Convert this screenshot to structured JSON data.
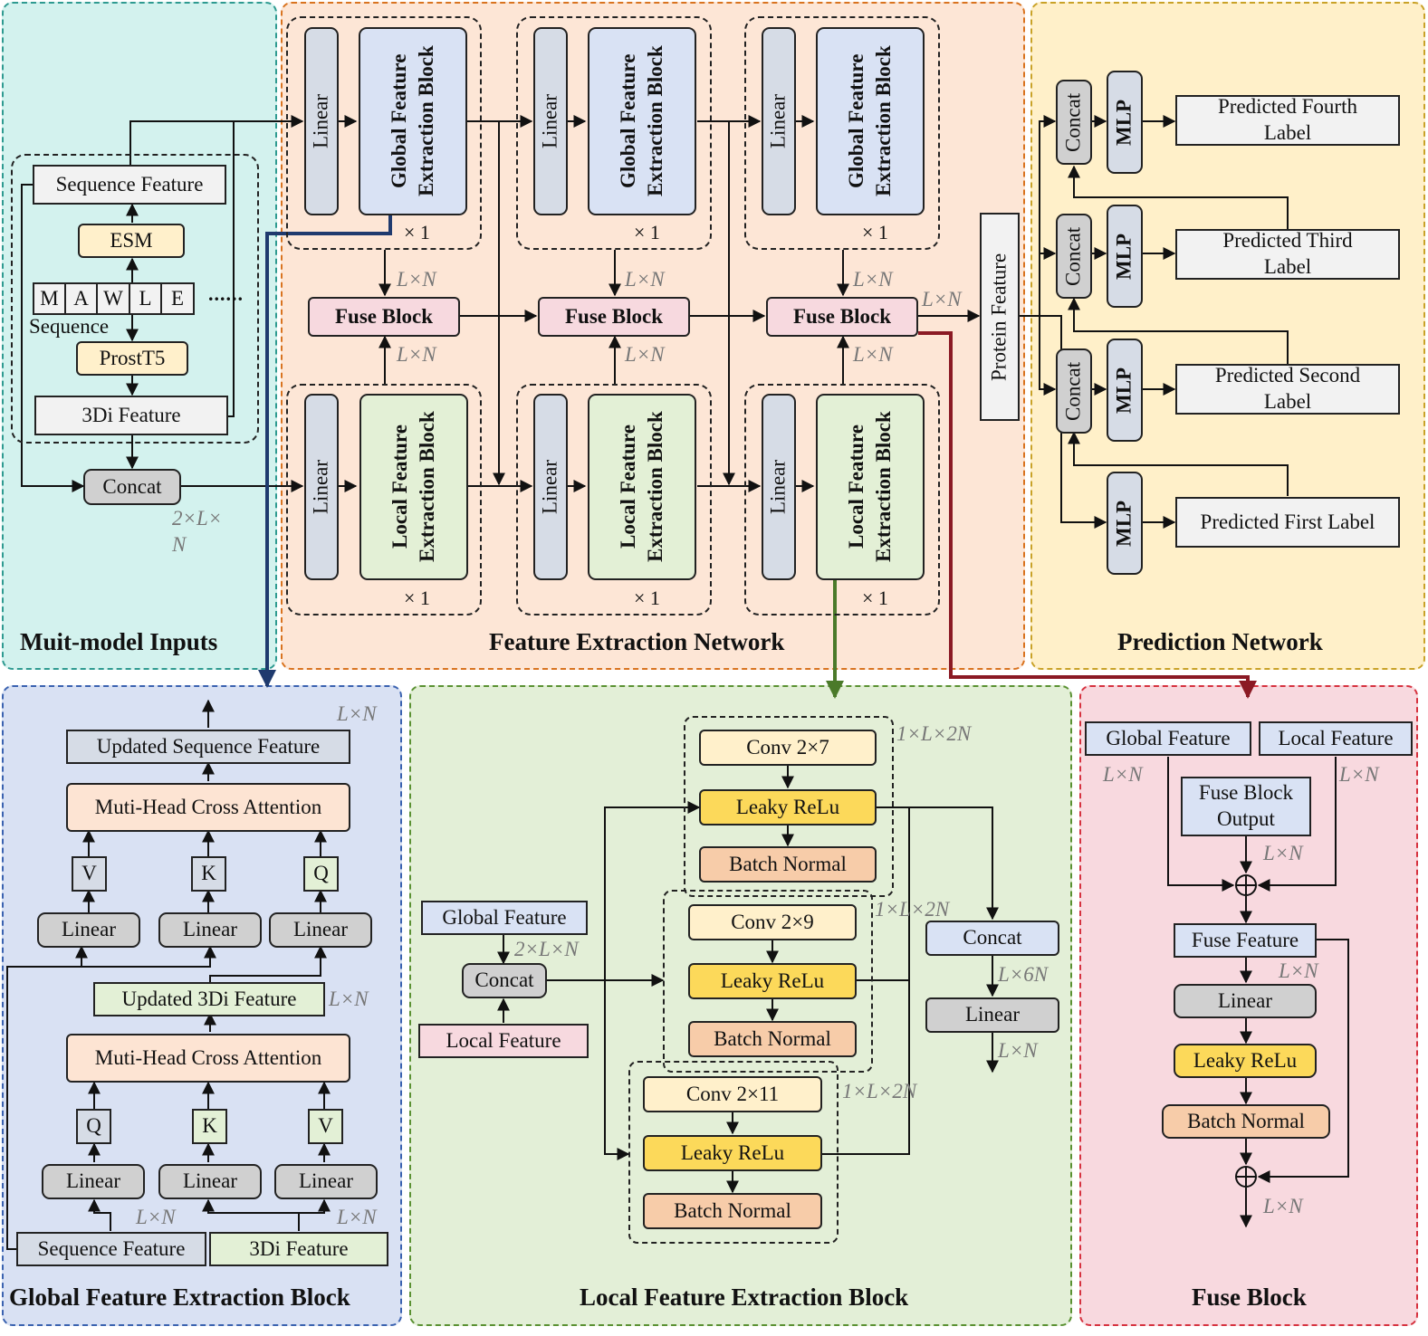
{
  "colors": {
    "inputs_panel": "#d3f2ee",
    "feature_panel": "#fde6d6",
    "prediction_panel": "#fff0c9",
    "global_panel": "#d9e1f3",
    "local_panel": "#e3efd7",
    "fuse_panel": "#f8d9df",
    "global_link": "#1f3a6e",
    "local_link": "#4b7a2a",
    "fuse_link": "#8b1a24"
  },
  "inputs": {
    "title": "Muit-model Inputs",
    "sequence_feature": "Sequence Feature",
    "esm": "ESM",
    "sequence_letters": [
      "M",
      "A",
      "W",
      "L",
      "E"
    ],
    "ellipsis": "......",
    "sequence_label": "Sequence",
    "prostt5": "ProstT5",
    "di3_feature": "3Di Feature",
    "concat": "Concat",
    "concat_dim_line1": "2×L×",
    "concat_dim_line2": "N"
  },
  "feature_network": {
    "title": "Feature Extraction Network",
    "linear": "Linear",
    "global_block": "Global Feature Extraction Block",
    "local_block": "Local Feature Extraction Block",
    "repeat": "× 1",
    "fuse_block": "Fuse Block",
    "dim": "L×N",
    "protein_feature": "Protein Feature"
  },
  "prediction": {
    "title": "Prediction Network",
    "concat": "Concat",
    "mlp": "MLP",
    "labels": [
      "Predicted Fourth Label",
      "Predicted Third Label",
      "Predicted Second Label",
      "Predicted First Label"
    ]
  },
  "global_block": {
    "title": "Global Feature Extraction Block",
    "updated_sequence": "Updated Sequence Feature",
    "attention": "Muti-Head Cross Attention",
    "updated_3di": "Updated 3Di Feature",
    "linear": "Linear",
    "top_qkv": [
      "V",
      "K",
      "Q"
    ],
    "bottom_qkv": [
      "Q",
      "K",
      "V"
    ],
    "sequence_feature": "Sequence Feature",
    "di3_feature": "3Di Feature",
    "dim": "L×N"
  },
  "local_block": {
    "title": "Local Feature Extraction Block",
    "global_feature": "Global Feature",
    "local_feature": "Local Feature",
    "concat": "Concat",
    "concat_dim": "2×L×N",
    "convs": [
      "Conv 2×7",
      "Conv 2×9",
      "Conv 2×11"
    ],
    "leaky": "Leaky ReLu",
    "batch": "Batch Normal",
    "branch_dim": "1×L×2N",
    "out_concat": "Concat",
    "out_concat_dim": "L×6N",
    "linear": "Linear",
    "out_dim": "L×N"
  },
  "fuse_block": {
    "title": "Fuse Block",
    "global_feature": "Global Feature",
    "local_feature": "Local Feature",
    "fuse_output": "Fuse Block Output",
    "fuse_feature": "Fuse Feature",
    "linear": "Linear",
    "leaky": "Leaky ReLu",
    "batch": "Batch Normal",
    "dim": "L×N"
  }
}
